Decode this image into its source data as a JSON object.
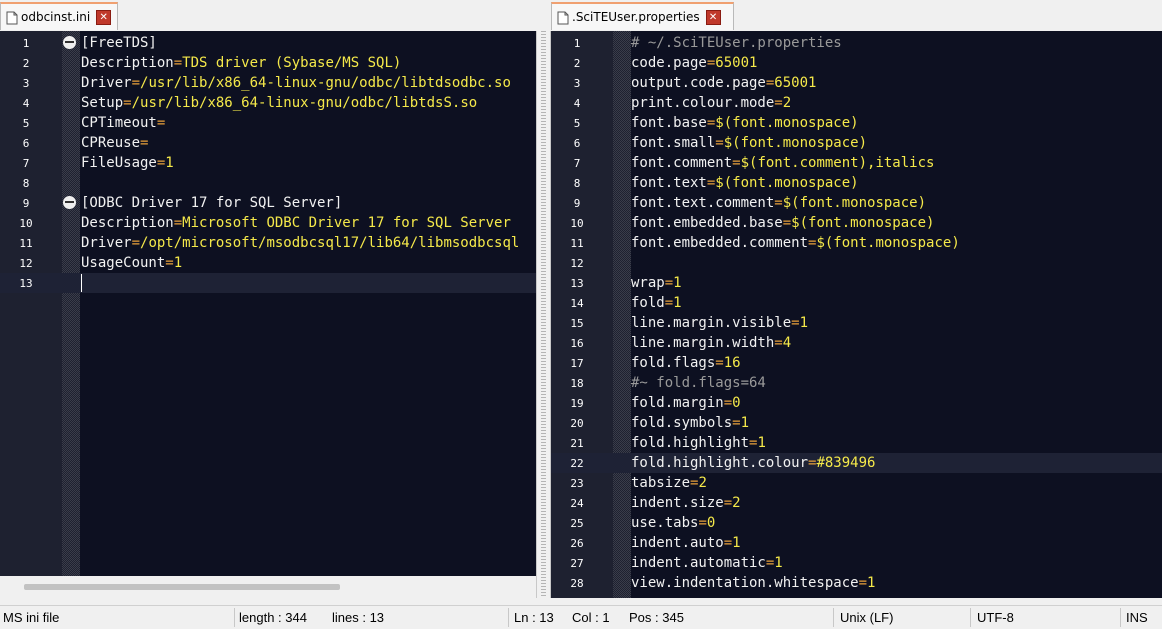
{
  "tabs": {
    "left": {
      "label": "odbcinst.ini"
    },
    "right": {
      "label": ".SciTEUser.properties"
    }
  },
  "left_editor": {
    "lines": [
      {
        "num": "1",
        "key": "[FreeTDS]",
        "eq": "",
        "val": "",
        "fold": true
      },
      {
        "num": "2",
        "key": "Description",
        "eq": "=",
        "val": "TDS driver (Sybase/MS SQL)"
      },
      {
        "num": "3",
        "key": "Driver",
        "eq": "=",
        "val": "/usr/lib/x86_64-linux-gnu/odbc/libtdsodbc.so"
      },
      {
        "num": "4",
        "key": "Setup",
        "eq": "=",
        "val": "/usr/lib/x86_64-linux-gnu/odbc/libtdsS.so"
      },
      {
        "num": "5",
        "key": "CPTimeout",
        "eq": "=",
        "val": ""
      },
      {
        "num": "6",
        "key": "CPReuse",
        "eq": "=",
        "val": ""
      },
      {
        "num": "7",
        "key": "FileUsage",
        "eq": "=",
        "val": "1"
      },
      {
        "num": "8",
        "key": "",
        "eq": "",
        "val": ""
      },
      {
        "num": "9",
        "key": "[ODBC Driver 17 for SQL Server]",
        "eq": "",
        "val": "",
        "fold": true
      },
      {
        "num": "10",
        "key": "Description",
        "eq": "=",
        "val": "Microsoft ODBC Driver 17 for SQL Server"
      },
      {
        "num": "11",
        "key": "Driver",
        "eq": "=",
        "val": "/opt/microsoft/msodbcsql17/lib64/libmsodbcsql"
      },
      {
        "num": "12",
        "key": "UsageCount",
        "eq": "=",
        "val": "1"
      },
      {
        "num": "13",
        "key": "",
        "eq": "",
        "val": "",
        "current": true
      }
    ]
  },
  "right_editor": {
    "lines": [
      {
        "num": "1",
        "comment": "# ~/.SciTEUser.properties"
      },
      {
        "num": "2",
        "key": "code.page",
        "eq": "=",
        "val": "65001"
      },
      {
        "num": "3",
        "key": "output.code.page",
        "eq": "=",
        "val": "65001"
      },
      {
        "num": "4",
        "key": "print.colour.mode",
        "eq": "=",
        "val": "2"
      },
      {
        "num": "5",
        "key": "font.base",
        "eq": "=",
        "val": "$(font.monospace)"
      },
      {
        "num": "6",
        "key": "font.small",
        "eq": "=",
        "val": "$(font.monospace)"
      },
      {
        "num": "7",
        "key": "font.comment",
        "eq": "=",
        "val": "$(font.comment),italics"
      },
      {
        "num": "8",
        "key": "font.text",
        "eq": "=",
        "val": "$(font.monospace)"
      },
      {
        "num": "9",
        "key": "font.text.comment",
        "eq": "=",
        "val": "$(font.monospace)"
      },
      {
        "num": "10",
        "key": "font.embedded.base",
        "eq": "=",
        "val": "$(font.monospace)"
      },
      {
        "num": "11",
        "key": "font.embedded.comment",
        "eq": "=",
        "val": "$(font.monospace)"
      },
      {
        "num": "12",
        "key": "",
        "eq": "",
        "val": ""
      },
      {
        "num": "13",
        "key": "wrap",
        "eq": "=",
        "val": "1"
      },
      {
        "num": "14",
        "key": "fold",
        "eq": "=",
        "val": "1"
      },
      {
        "num": "15",
        "key": "line.margin.visible",
        "eq": "=",
        "val": "1"
      },
      {
        "num": "16",
        "key": "line.margin.width",
        "eq": "=",
        "val": "4"
      },
      {
        "num": "17",
        "key": "fold.flags",
        "eq": "=",
        "val": "16"
      },
      {
        "num": "18",
        "comment": "#~ fold.flags=64"
      },
      {
        "num": "19",
        "key": "fold.margin",
        "eq": "=",
        "val": "0"
      },
      {
        "num": "20",
        "key": "fold.symbols",
        "eq": "=",
        "val": "1"
      },
      {
        "num": "21",
        "key": "fold.highlight",
        "eq": "=",
        "val": "1"
      },
      {
        "num": "22",
        "key": "fold.highlight.colour",
        "eq": "=",
        "val": "#839496",
        "current": true
      },
      {
        "num": "23",
        "key": "tabsize",
        "eq": "=",
        "val": "2"
      },
      {
        "num": "24",
        "key": "indent.size",
        "eq": "=",
        "val": "2"
      },
      {
        "num": "25",
        "key": "use.tabs",
        "eq": "=",
        "val": "0"
      },
      {
        "num": "26",
        "key": "indent.auto",
        "eq": "=",
        "val": "1"
      },
      {
        "num": "27",
        "key": "indent.automatic",
        "eq": "=",
        "val": "1"
      },
      {
        "num": "28",
        "key": "view.indentation.whitespace",
        "eq": "=",
        "val": "1"
      }
    ]
  },
  "statusbar": {
    "lexer": "MS ini file",
    "length": "length : 344",
    "lines": "lines : 13",
    "ln": "Ln : 13",
    "col": "Col : 1",
    "pos": "Pos : 345",
    "eol": "Unix (LF)",
    "encoding": "UTF-8",
    "mode": "INS"
  }
}
